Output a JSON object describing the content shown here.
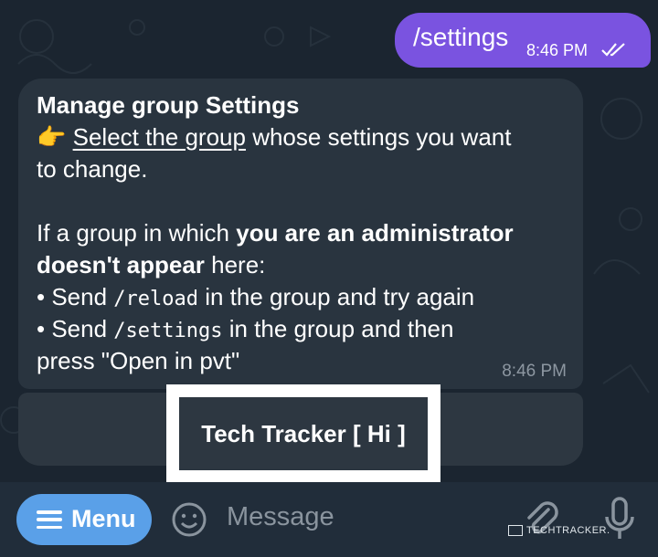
{
  "outgoing": {
    "text": "/settings",
    "time": "8:46 PM"
  },
  "incoming": {
    "title": "Manage group Settings",
    "pointer_emoji": "👉",
    "link_text": "Select the group",
    "line2_rest": " whose settings you want",
    "line3": "to change.",
    "para2_start": "If a group in which ",
    "para2_bold1": "you are an administrator",
    "para2_bold2": "doesn't appear",
    "para2_end": " here:",
    "bullet1_pre": "• Send ",
    "bullet1_code": "/reload",
    "bullet1_post": " in the group and try again",
    "bullet2_pre": "• Send ",
    "bullet2_code": "/settings",
    "bullet2_post": " in the group and then",
    "last_line": "press \"Open in pvt\"",
    "time": "8:46 PM"
  },
  "keyboard": {
    "button_label": "Tech Tracker [ Hi ]"
  },
  "bottom": {
    "menu_label": "Menu",
    "message_placeholder": "Message",
    "watermark": "TECHTRACKER."
  },
  "colors": {
    "background": "#1b2530",
    "outgoing_bubble": "#7a53e0",
    "incoming_bubble": "#29343f",
    "menu_button": "#5aa0e8",
    "highlight_border": "#ffffff"
  },
  "icons": [
    "double-check-icon",
    "menu-hamburger-icon",
    "emoji-icon",
    "attach-paperclip-icon",
    "microphone-icon"
  ]
}
